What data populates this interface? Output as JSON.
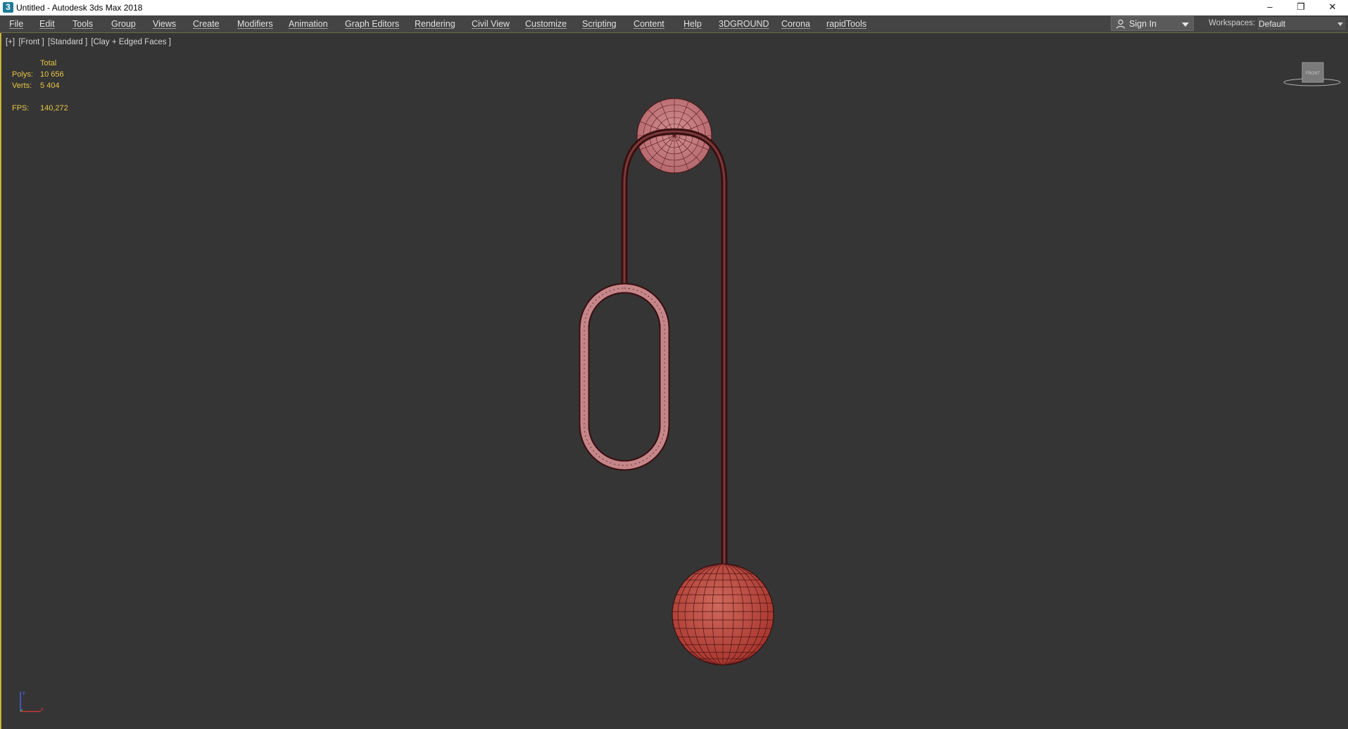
{
  "window": {
    "title": "Untitled - Autodesk 3ds Max 2018",
    "icon": "3ds-max-icon",
    "controls": [
      "minimize",
      "restore",
      "close"
    ]
  },
  "menu": {
    "items": [
      "File",
      "Edit",
      "Tools",
      "Group",
      "Views",
      "Create",
      "Modifiers",
      "Animation",
      "Graph Editors",
      "Rendering",
      "Civil View",
      "Customize",
      "Scripting",
      "Content",
      "Help",
      "3DGROUND",
      "Corona",
      "rapidTools"
    ],
    "sign_in": "Sign In",
    "workspaces_label": "Workspaces:",
    "workspace_value": "Default"
  },
  "viewport": {
    "label_parts": [
      "[+]",
      "[Front ]",
      "[Standard ]",
      "[Clay + Edged Faces ]"
    ],
    "stats": {
      "header": "Total",
      "polys_label": "Polys:",
      "polys_value": "10 656",
      "verts_label": "Verts:",
      "verts_value": "5 404",
      "fps_label": "FPS:",
      "fps_value": "140,272"
    },
    "viewcube_label": "FRONT"
  },
  "colors": {
    "viewport_bg": "#353535",
    "menu_bg": "#444444",
    "stat_text": "#e8c547",
    "mesh_fill": "#c07a7e",
    "mesh_edge": "#3a0f10",
    "sphere_fill": "#b8453c",
    "active_border": "#c9b23a"
  }
}
